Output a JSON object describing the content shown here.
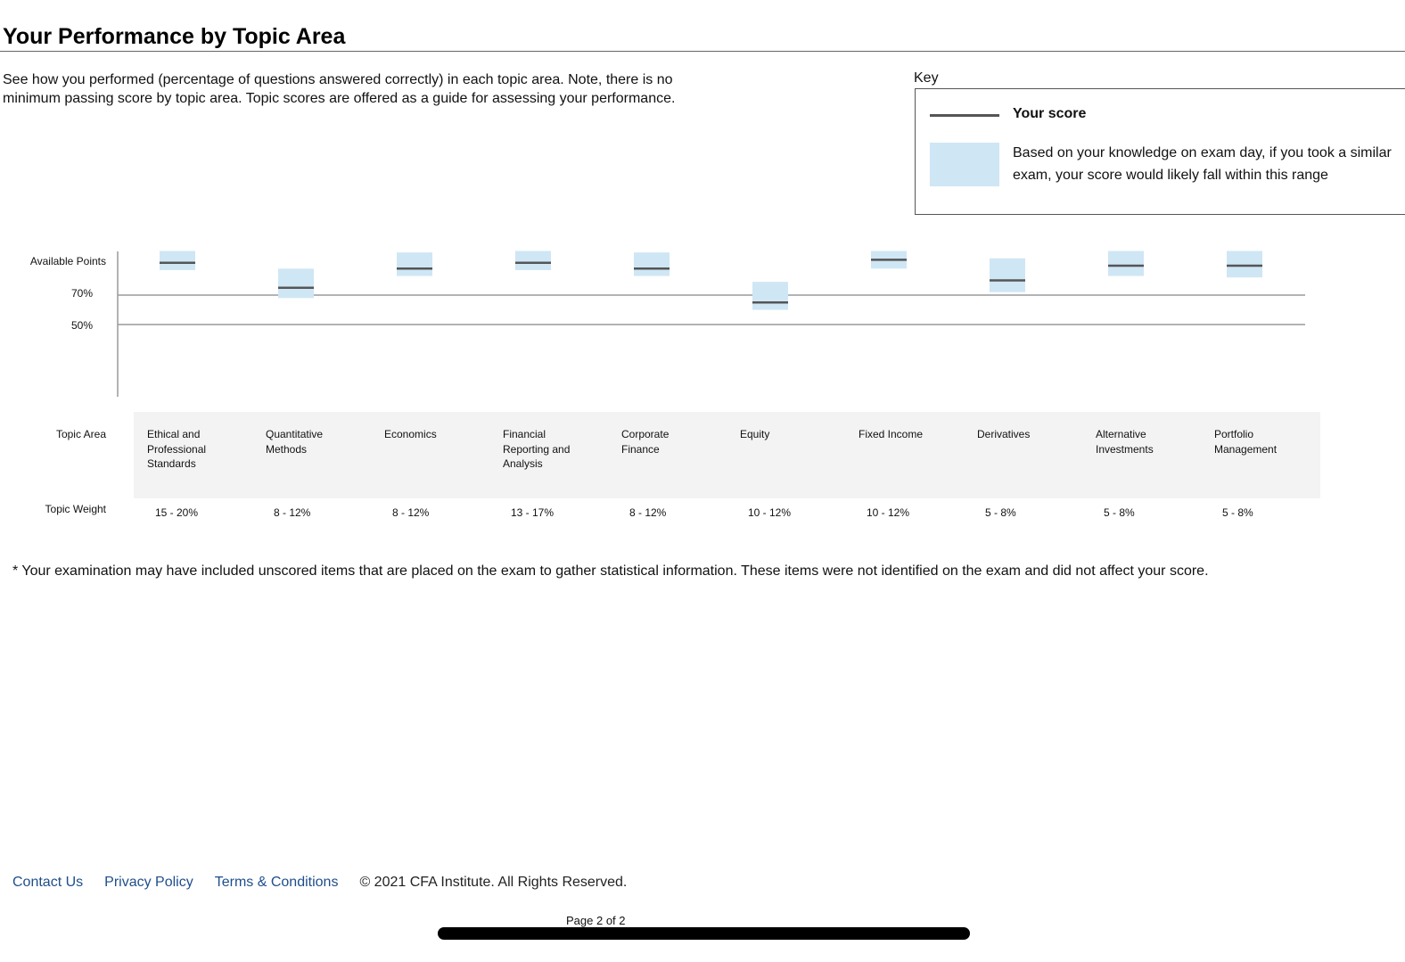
{
  "title": "Your Performance by Topic Area",
  "intro": "See how you performed (percentage of questions answered correctly) in each topic area. Note, there is no minimum passing score by topic area. Topic scores are offered as a guide for assessing your performance.",
  "key": {
    "label": "Key",
    "score_label": "Your score",
    "range_label": "Based on your knowledge on exam day, if you took a similar exam, your score would likely fall within this range"
  },
  "chart_data": {
    "type": "range",
    "y_axis_labels": [
      "Available Points",
      "70%",
      "50%"
    ],
    "reference_lines": [
      70,
      50
    ],
    "ylim": [
      30,
      100
    ],
    "series": [
      {
        "name": "Your score",
        "values": [
          92,
          75,
          88,
          92,
          88,
          65,
          94,
          80,
          90,
          90
        ]
      },
      {
        "name": "Range low",
        "values": [
          87,
          68,
          83,
          87,
          83,
          60,
          88,
          72,
          83,
          82
        ]
      },
      {
        "name": "Range high",
        "values": [
          100,
          88,
          99,
          100,
          99,
          79,
          100,
          95,
          100,
          100
        ]
      }
    ],
    "categories": [
      "Ethical and Professional Standards",
      "Quantitative Methods",
      "Economics",
      "Financial Reporting and Analysis",
      "Corporate Finance",
      "Equity",
      "Fixed Income",
      "Derivatives",
      "Alternative Investments",
      "Portfolio Management"
    ],
    "topic_area_label": "Topic Area",
    "topic_weight_label": "Topic Weight",
    "topic_area_lines": [
      [
        "Ethical and",
        "Professional",
        "Standards"
      ],
      [
        "Quantitative",
        "Methods"
      ],
      [
        "Economics"
      ],
      [
        "Financial",
        "Reporting and",
        "Analysis"
      ],
      [
        "Corporate",
        "Finance"
      ],
      [
        "Equity"
      ],
      [
        "Fixed Income"
      ],
      [
        "Derivatives"
      ],
      [
        "Alternative",
        "Investments"
      ],
      [
        "Portfolio",
        "Management"
      ]
    ],
    "topic_weights": [
      "15 - 20%",
      "8 - 12%",
      "8 - 12%",
      "13 - 17%",
      "8 - 12%",
      "10 - 12%",
      "10 - 12%",
      "5 - 8%",
      "5 - 8%",
      "5 - 8%"
    ]
  },
  "colors": {
    "range_fill": "#cfe6f5",
    "score_line": "#555555",
    "link": "#1f4e8c"
  },
  "footnote": "* Your examination may have included unscored items that are placed on the exam to gather statistical information. These items were not identified on the exam and did not affect your score.",
  "footer": {
    "links": [
      "Contact Us",
      "Privacy Policy",
      "Terms & Conditions"
    ],
    "copyright": "© 2021 CFA Institute. All Rights Reserved."
  },
  "page_indicator": "Page 2 of 2"
}
